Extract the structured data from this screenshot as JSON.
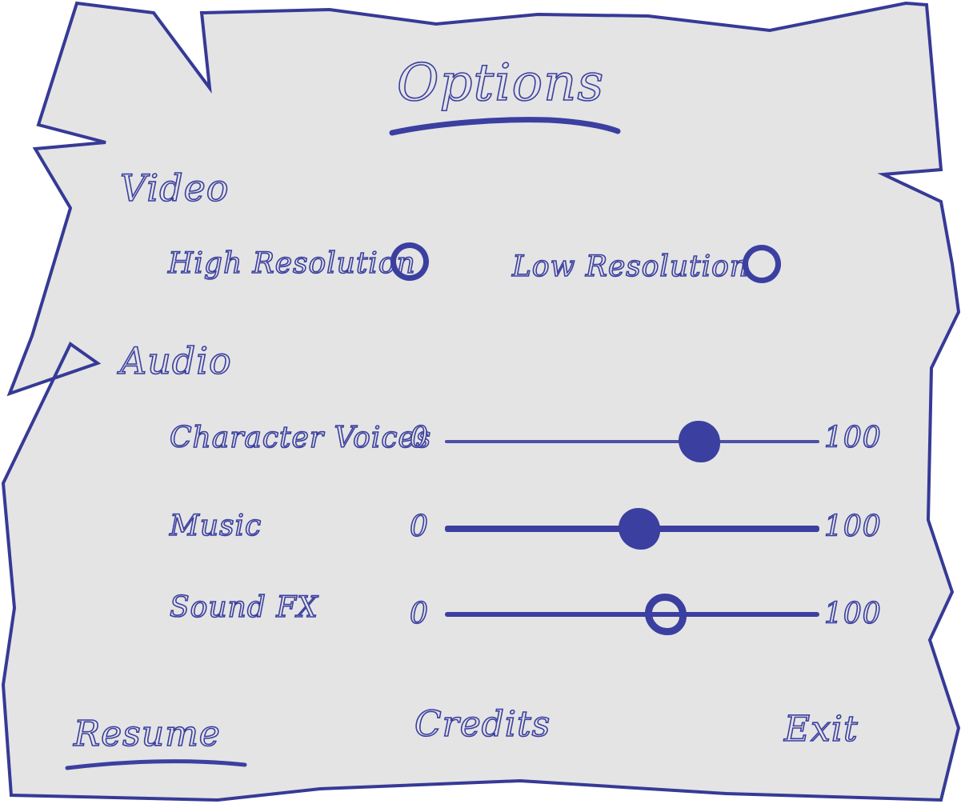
{
  "title": "Options",
  "video": {
    "heading": "Video",
    "high_resolution": "High Resolution",
    "low_resolution": "Low Resolution"
  },
  "audio": {
    "heading": "Audio",
    "sliders": [
      {
        "label": "Character Voices",
        "min": "0",
        "max": "100",
        "value": 68
      },
      {
        "label": "Music",
        "min": "0",
        "max": "100",
        "value": 52
      },
      {
        "label": "Sound FX",
        "min": "0",
        "max": "100",
        "value": 59
      }
    ]
  },
  "menu": {
    "resume": "Resume",
    "credits": "Credits",
    "exit": "Exit"
  },
  "colors": {
    "ink": "#3b3fa0",
    "paper": "#e4e4e4"
  }
}
